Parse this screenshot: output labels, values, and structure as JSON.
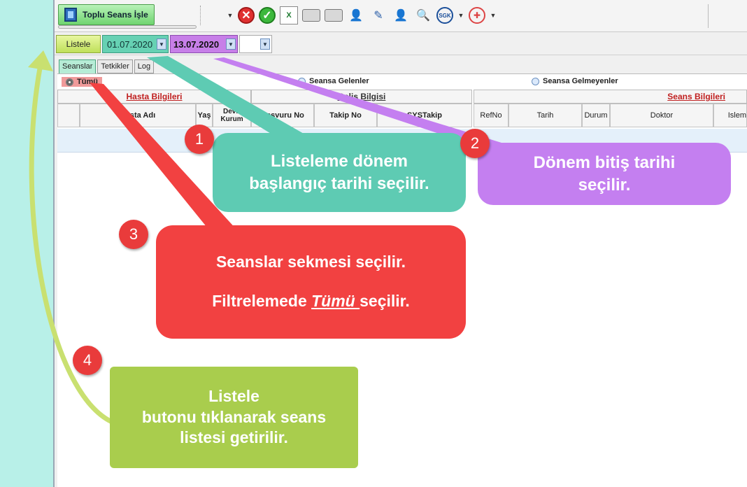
{
  "toolbar": {
    "toplu_label": "Toplu Seans İşle",
    "icons": [
      "close-icon",
      "check-icon",
      "excel-icon",
      "printer-icon",
      "printer-icon",
      "user-info-icon",
      "edit-icon",
      "user-icon",
      "user-search-icon",
      "sgk-icon",
      "ministry-icon"
    ],
    "sgk_text": "SGK"
  },
  "filter": {
    "listele_label": "Listele",
    "start_date": "01.07.2020",
    "end_date": "13.07.2020"
  },
  "tabs": [
    {
      "label": "Seanslar"
    },
    {
      "label": "Tetkikler"
    },
    {
      "label": "Log"
    }
  ],
  "radios": {
    "tumu": "Tümü",
    "gelenler": "Seansa Gelenler",
    "gelmeyenler": "Seansa Gelmeyenler"
  },
  "grid": {
    "groups": {
      "hasta": "Hasta Bilgileri",
      "gelis": "Geliş Bilgisi",
      "seans": "Seans Bilgileri"
    },
    "columns": {
      "hasta_adi": "Hasta Adı",
      "yas": "Yaş",
      "devir_kurum": "Devir Kurum",
      "basvuru_no": "Başvuru No",
      "takip_no": "Takip No",
      "systakip": "SYSTakip",
      "refno": "RefNo",
      "tarih": "Tarih",
      "durum": "Durum",
      "doktor": "Doktor",
      "islem": "Islem"
    }
  },
  "callouts": {
    "c1": "Listeleme dönem başlangıç tarihi seçilir.",
    "c2_line1": "Dönem bitiş tarihi",
    "c2_line2": "seçilir.",
    "c3_line1": "Seanslar sekmesi seçilir.",
    "c3_pre": "Filtrelemede ",
    "c3_em": "Tümü ",
    "c3_post": "seçilir.",
    "c4_line1": "Listele",
    "c4_line2": "butonu tıklanarak seans",
    "c4_line3": "listesi getirilir."
  },
  "steps": [
    "1",
    "2",
    "3",
    "4"
  ],
  "colors": {
    "teal": "#5ecbb3",
    "purple": "#c47ff0",
    "red": "#f24141",
    "green": "#a9cd4d",
    "badge": "#e93b3b"
  }
}
